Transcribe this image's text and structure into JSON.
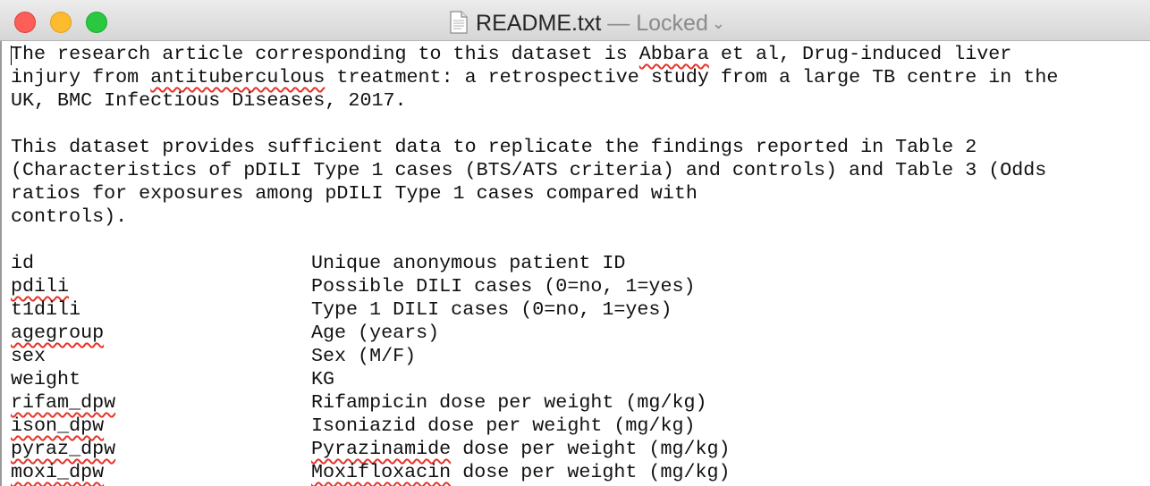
{
  "window": {
    "title": "README.txt",
    "title_separator": " — ",
    "status": "Locked",
    "chevron": "⌄",
    "title_icon": "text-document-icon",
    "controls": {
      "close_color": "#fc5f57",
      "minimize_color": "#fdbc2e",
      "zoom_color": "#28c840"
    }
  },
  "document": {
    "paragraph1": [
      [
        {
          "t": "The research article corresponding to this dataset is "
        },
        {
          "t": "Abbara",
          "m": true
        },
        {
          "t": " et al, Drug-induced liver"
        }
      ],
      [
        {
          "t": "injury from "
        },
        {
          "t": "antituberculous",
          "m": true
        },
        {
          "t": " treatment: a retrospective study from a large TB centre in the"
        }
      ],
      [
        {
          "t": "UK, BMC Infectious Diseases, 2017."
        }
      ]
    ],
    "paragraph2": [
      [
        {
          "t": "This dataset provides sufficient data to replicate the findings reported in Table 2"
        }
      ],
      [
        {
          "t": "(Characteristics of pDILI Type 1 cases (BTS/ATS criteria) and controls) and Table 3 (Odds"
        }
      ],
      [
        {
          "t": "ratios for exposures among pDILI Type 1 cases compared with"
        }
      ],
      [
        {
          "t": "controls)."
        }
      ]
    ],
    "variables": [
      {
        "name": "id",
        "name_misspelled": false,
        "desc": [
          {
            "t": "Unique anonymous patient ID"
          }
        ]
      },
      {
        "name": "pdili",
        "name_misspelled": true,
        "desc": [
          {
            "t": "Possible DILI cases (0=no, 1=yes)"
          }
        ]
      },
      {
        "name": "t1dili",
        "name_misspelled": false,
        "desc": [
          {
            "t": "Type 1 DILI cases (0=no, 1=yes)"
          }
        ]
      },
      {
        "name": "agegroup",
        "name_misspelled": true,
        "desc": [
          {
            "t": "Age (years)"
          }
        ]
      },
      {
        "name": "sex",
        "name_misspelled": false,
        "desc": [
          {
            "t": "Sex (M/F)"
          }
        ]
      },
      {
        "name": "weight",
        "name_misspelled": false,
        "desc": [
          {
            "t": "KG"
          }
        ]
      },
      {
        "name": "rifam_dpw",
        "name_misspelled": true,
        "desc": [
          {
            "t": "Rifampicin dose per weight (mg/kg)"
          }
        ]
      },
      {
        "name": "ison_dpw",
        "name_misspelled": true,
        "desc": [
          {
            "t": "Isoniazid dose per weight (mg/kg)"
          }
        ]
      },
      {
        "name": "pyraz_dpw",
        "name_misspelled": true,
        "desc": [
          {
            "t": "Pyrazinamide",
            "m": true
          },
          {
            "t": " dose per weight (mg/kg)"
          }
        ]
      },
      {
        "name": "moxi_dpw",
        "name_misspelled": true,
        "desc": [
          {
            "t": "Moxifloxacin",
            "m": true
          },
          {
            "t": " dose per weight (mg/kg)"
          }
        ]
      }
    ]
  }
}
